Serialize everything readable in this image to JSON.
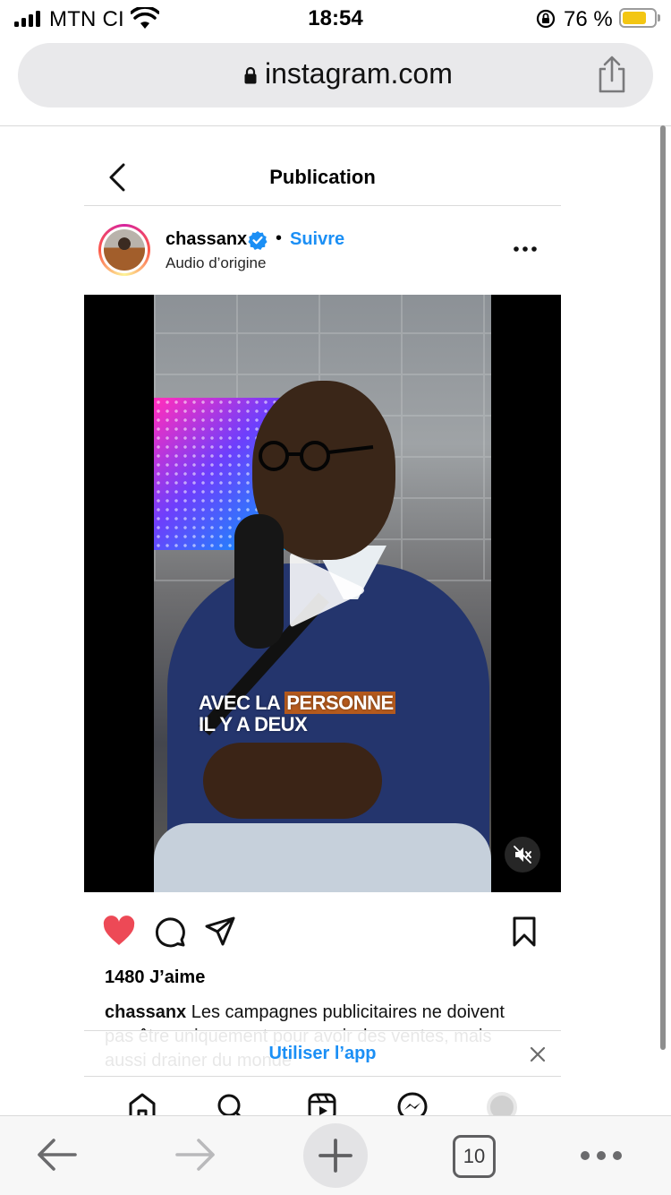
{
  "status_bar": {
    "carrier": "MTN CI",
    "time": "18:54",
    "battery_percent": "76 %",
    "battery_level": 0.76,
    "battery_color": "#f3c613"
  },
  "browser": {
    "url": "instagram.com",
    "icons": [
      "padlock-icon",
      "share-icon"
    ]
  },
  "page": {
    "title": "Publication",
    "back_icon": "chevron-left-icon"
  },
  "post": {
    "username": "chassanx",
    "verified_icon": "verified-badge-icon",
    "separator": "•",
    "follow_label": "Suivre",
    "audio_label": "Audio d’origine",
    "more_icon": "more-horizontal-icon",
    "video": {
      "caption_line1_prefix": "AVEC LA ",
      "caption_line1_highlight": "PERSONNE",
      "caption_line2": "IL Y A DEUX",
      "play_icon": "play-icon",
      "mute_icon": "muted-speaker-icon"
    },
    "actions": {
      "like_icon": "heart-filled-icon",
      "comment_icon": "comment-icon",
      "share_icon": "send-icon",
      "save_icon": "bookmark-icon",
      "like_color": "#ed4956"
    },
    "likes_count": "1480",
    "likes_label": "J’aime",
    "caption_username": "chassanx",
    "caption_text": "Les campagnes publicitaires ne doivent pas être uniquement pour avoir des ventes, mais aussi drainer du monde"
  },
  "app_banner": {
    "label": "Utiliser l’app",
    "close_icon": "close-icon",
    "accent": "#1b8ff5"
  },
  "ig_nav": [
    "home-icon",
    "search-icon",
    "reels-icon",
    "messenger-icon",
    "profile-avatar-icon"
  ],
  "safari_toolbar": {
    "tabs_count": "10",
    "icons": [
      "back-arrow-icon",
      "forward-arrow-icon",
      "plus-icon",
      "tabs-icon",
      "more-icon"
    ]
  }
}
